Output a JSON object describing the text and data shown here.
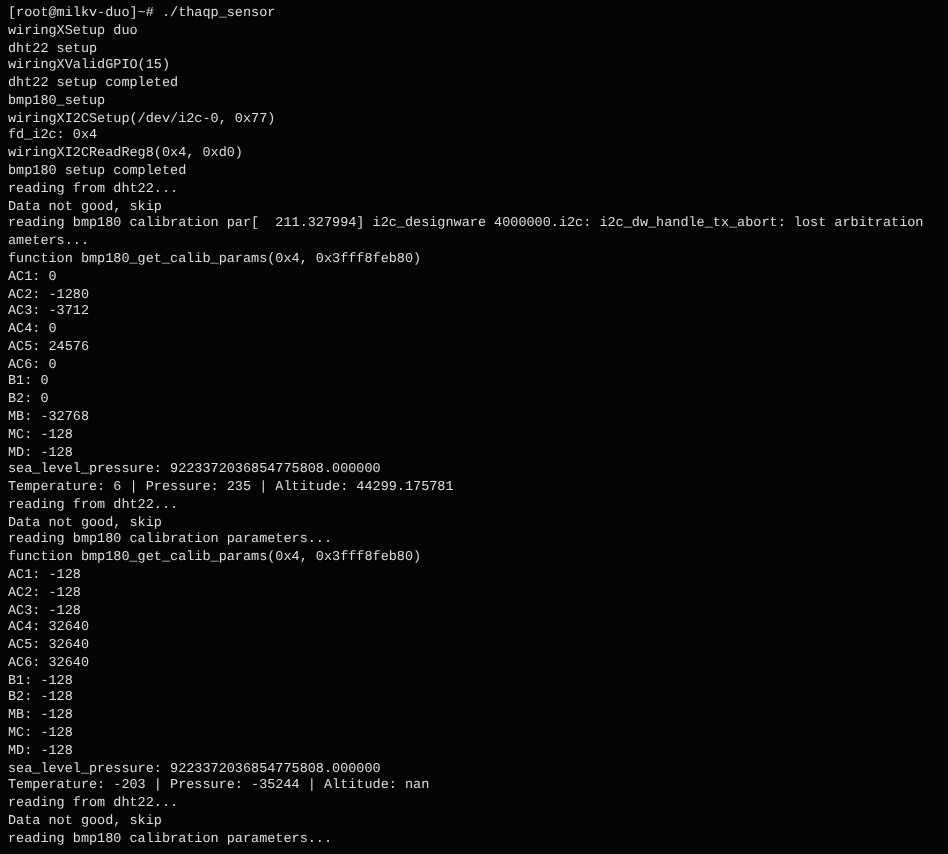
{
  "terminal": {
    "lines": [
      "[root@milkv-duo]~# ./thaqp_sensor",
      "wiringXSetup duo",
      "dht22 setup",
      "wiringXValidGPIO(15)",
      "dht22 setup completed",
      "bmp180_setup",
      "wiringXI2CSetup(/dev/i2c-0, 0x77)",
      "fd_i2c: 0x4",
      "wiringXI2CReadReg8(0x4, 0xd0)",
      "bmp180 setup completed",
      "reading from dht22...",
      "Data not good, skip",
      "reading bmp180 calibration par[  211.327994] i2c_designware 4000000.i2c: i2c_dw_handle_tx_abort: lost arbitration",
      "ameters...",
      "function bmp180_get_calib_params(0x4, 0x3fff8feb80)",
      "AC1: 0",
      "AC2: -1280",
      "AC3: -3712",
      "AC4: 0",
      "AC5: 24576",
      "AC6: 0",
      "B1: 0",
      "B2: 0",
      "MB: -32768",
      "MC: -128",
      "MD: -128",
      "sea_level_pressure: 9223372036854775808.000000",
      "Temperature: 6 | Pressure: 235 | Altitude: 44299.175781",
      "reading from dht22...",
      "Data not good, skip",
      "reading bmp180 calibration parameters...",
      "function bmp180_get_calib_params(0x4, 0x3fff8feb80)",
      "AC1: -128",
      "AC2: -128",
      "AC3: -128",
      "AC4: 32640",
      "AC5: 32640",
      "AC6: 32640",
      "B1: -128",
      "B2: -128",
      "MB: -128",
      "MC: -128",
      "MD: -128",
      "sea_level_pressure: 9223372036854775808.000000",
      "Temperature: -203 | Pressure: -35244 | Altitude: nan",
      "reading from dht22...",
      "Data not good, skip",
      "reading bmp180 calibration parameters..."
    ]
  }
}
